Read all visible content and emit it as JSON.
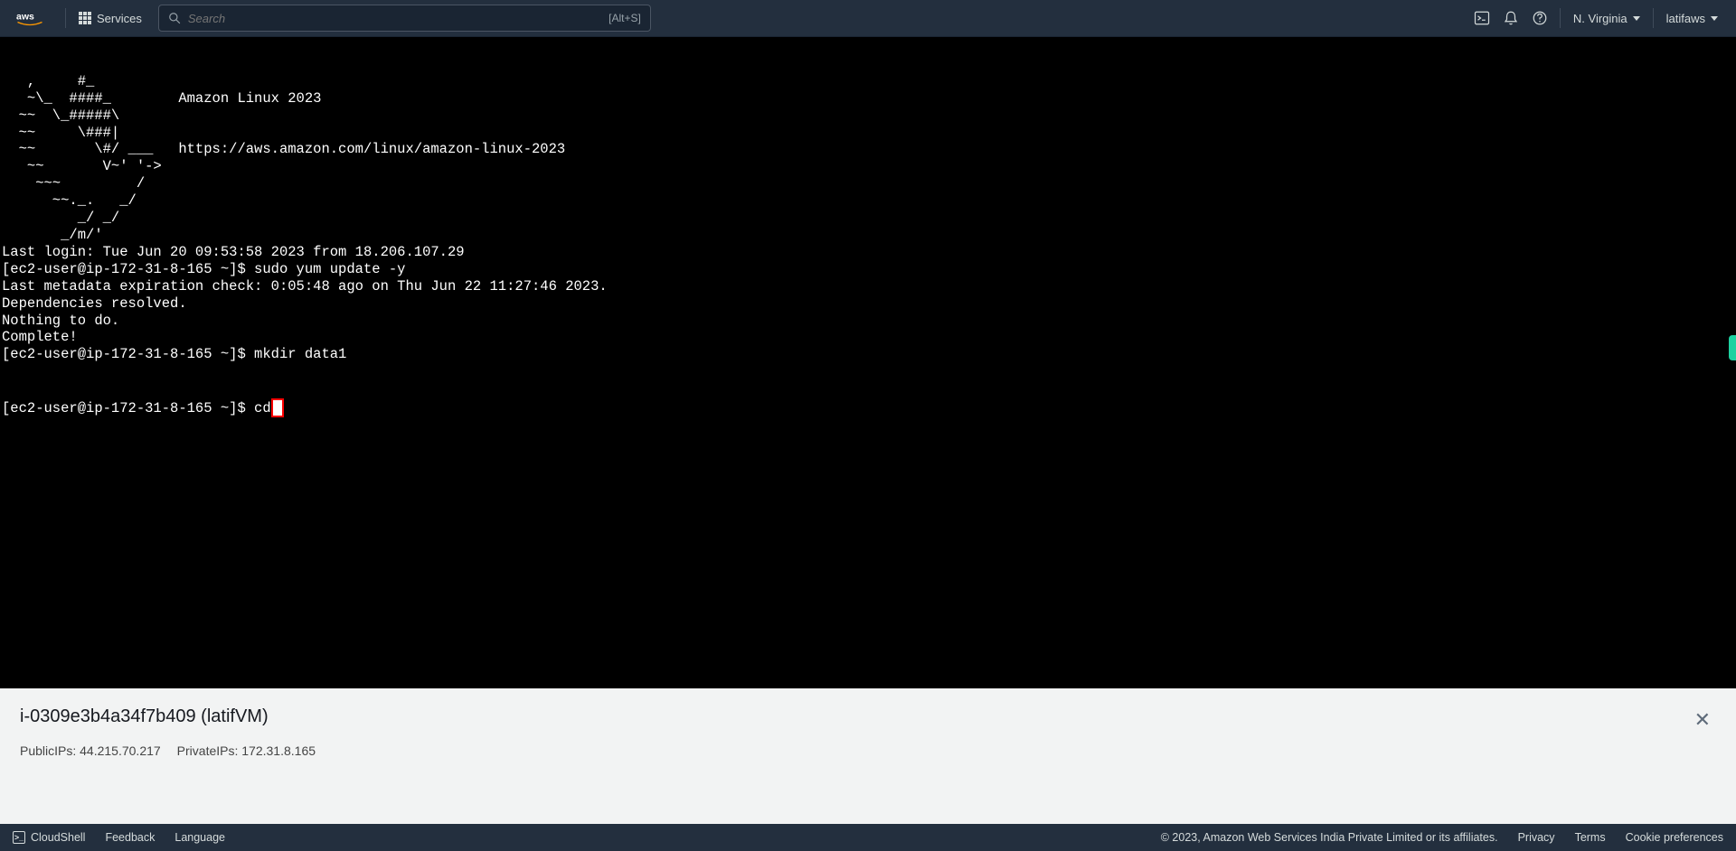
{
  "topnav": {
    "services_label": "Services",
    "search_placeholder": "Search",
    "search_kbd": "[Alt+S]",
    "region_label": "N. Virginia",
    "account_label": "latifaws"
  },
  "terminal": {
    "lines": [
      "   ,     #_",
      "   ~\\_  ####_        Amazon Linux 2023",
      "  ~~  \\_#####\\",
      "  ~~     \\###|",
      "  ~~       \\#/ ___   https://aws.amazon.com/linux/amazon-linux-2023",
      "   ~~       V~' '->",
      "    ~~~         /",
      "      ~~._.   _/",
      "         _/ _/",
      "       _/m/'",
      "Last login: Tue Jun 20 09:53:58 2023 from 18.206.107.29",
      "[ec2-user@ip-172-31-8-165 ~]$ sudo yum update -y",
      "Last metadata expiration check: 0:05:48 ago on Thu Jun 22 11:27:46 2023.",
      "Dependencies resolved.",
      "Nothing to do.",
      "Complete!",
      "[ec2-user@ip-172-31-8-165 ~]$ mkdir data1"
    ],
    "current_prompt": "[ec2-user@ip-172-31-8-165 ~]$ cd"
  },
  "infopanel": {
    "title": "i-0309e3b4a34f7b409 (latifVM)",
    "public_ip_label": "PublicIPs:",
    "public_ip": "44.215.70.217",
    "private_ip_label": "PrivateIPs:",
    "private_ip": "172.31.8.165"
  },
  "bottombar": {
    "cloudshell": "CloudShell",
    "feedback": "Feedback",
    "language": "Language",
    "copyright": "© 2023, Amazon Web Services India Private Limited or its affiliates.",
    "privacy": "Privacy",
    "terms": "Terms",
    "cookies": "Cookie preferences"
  }
}
